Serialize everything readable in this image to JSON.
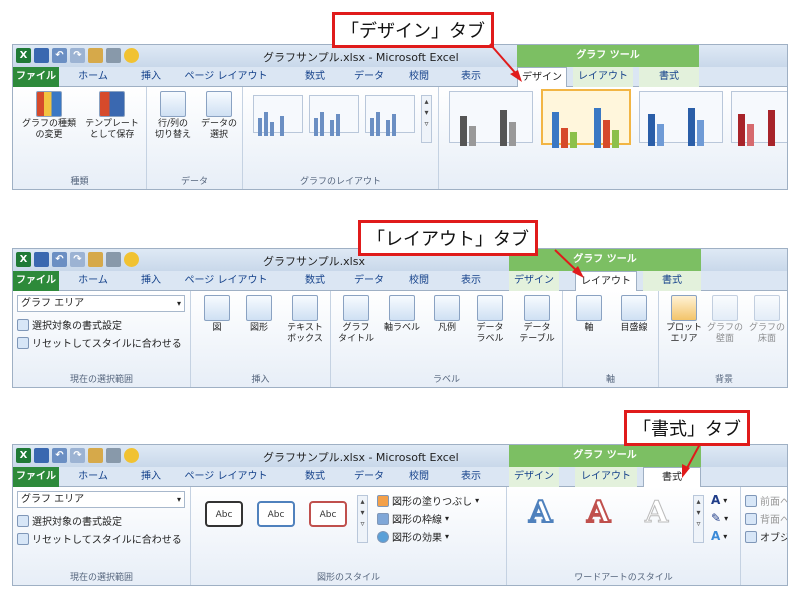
{
  "panels": {
    "design": {
      "callout": "「デザイン」タブ",
      "title": "グラフサンプル.xlsx - Microsoft Excel",
      "context_header": "グラフ ツール",
      "tabs": [
        "ファイル",
        "ホーム",
        "挿入",
        "ページ レイアウト",
        "数式",
        "データ",
        "校閲",
        "表示",
        "デザイン",
        "レイアウト",
        "書式"
      ],
      "groups": {
        "type": {
          "label": "種類",
          "buttons": [
            "グラフの種類\nの変更",
            "テンプレート\nとして保存"
          ]
        },
        "data": {
          "label": "データ",
          "buttons": [
            "行/列の\n切り替え",
            "データの\n選択"
          ]
        },
        "layout": {
          "label": "グラフのレイアウト"
        }
      }
    },
    "layout": {
      "callout": "「レイアウト」タブ",
      "title": "グラフサンプル.xlsx",
      "context_header": "グラフ ツール",
      "tabs": [
        "ファイル",
        "ホーム",
        "挿入",
        "ページ レイアウト",
        "数式",
        "データ",
        "校閲",
        "表示",
        "デザイン",
        "レイアウト",
        "書式"
      ],
      "selection": {
        "dropdown": "グラフ エリア",
        "format_selection": "選択対象の書式設定",
        "reset_style": "リセットしてスタイルに合わせる",
        "label": "現在の選択範囲"
      },
      "insert": {
        "label": "挿入",
        "buttons": [
          "図",
          "図形",
          "テキスト\nボックス"
        ]
      },
      "labels": {
        "label": "ラベル",
        "buttons": [
          "グラフ\nタイトル",
          "軸ラベル",
          "凡例",
          "データ\nラベル",
          "データ\nテーブル"
        ]
      },
      "axes": {
        "label": "軸",
        "buttons": [
          "軸",
          "目盛線"
        ]
      },
      "background": {
        "label": "背景",
        "buttons": [
          "プロット\nエリア",
          "グラフの\n壁面",
          "グラフの\n床面"
        ]
      }
    },
    "format": {
      "callout": "「書式」タブ",
      "title": "グラフサンプル.xlsx - Microsoft Excel",
      "context_header": "グラフ ツール",
      "tabs": [
        "ファイル",
        "ホーム",
        "挿入",
        "ページ レイアウト",
        "数式",
        "データ",
        "校閲",
        "表示",
        "デザイン",
        "レイアウト",
        "書式"
      ],
      "selection": {
        "dropdown": "グラフ エリア",
        "format_selection": "選択対象の書式設定",
        "reset_style": "リセットしてスタイルに合わせる",
        "label": "現在の選択範囲"
      },
      "shape_styles": {
        "label": "図形のスタイル",
        "abc": [
          "Abc",
          "Abc",
          "Abc"
        ],
        "fill": "図形の塗りつぶし",
        "outline": "図形の枠線",
        "effects": "図形の効果"
      },
      "wordart": {
        "label": "ワードアートのスタイル",
        "letter": "A"
      },
      "arrange": {
        "front": "前面へ",
        "back": "背面へ",
        "pane": "オブジェ"
      }
    }
  },
  "colors": {
    "callout_border": "#e01b1b",
    "file_tab": "#2d8a3a",
    "context": "#7cbf63",
    "selected": "#f2b544"
  }
}
